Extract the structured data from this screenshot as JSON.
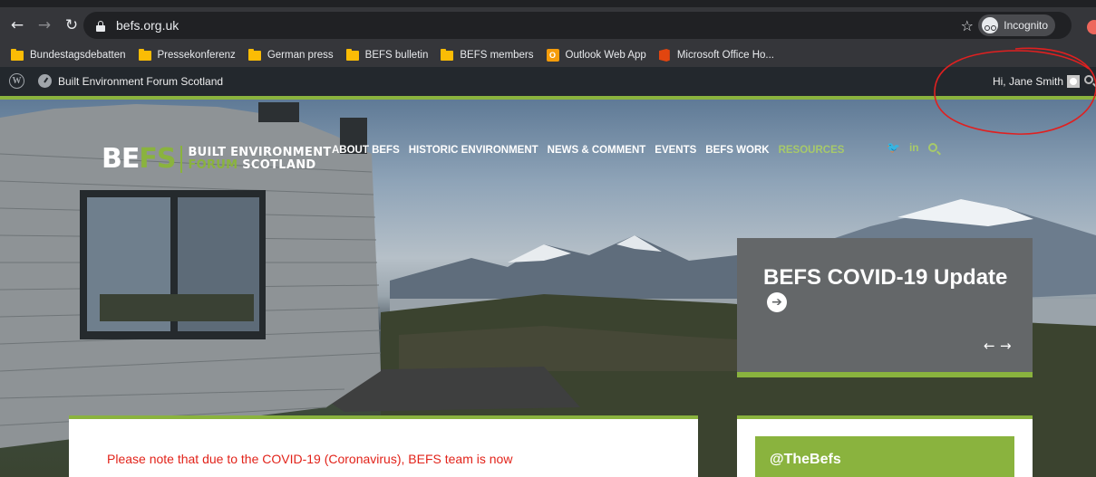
{
  "browser": {
    "url": "befs.org.uk",
    "incognito_label": "Incognito",
    "bookmarks": [
      {
        "label": "Bundestagsdebatten",
        "icon": "folder-icon"
      },
      {
        "label": "Pressekonferenz",
        "icon": "folder-icon"
      },
      {
        "label": "German press",
        "icon": "folder-icon"
      },
      {
        "label": "BEFS bulletin",
        "icon": "folder-icon"
      },
      {
        "label": "BEFS members",
        "icon": "folder-icon"
      },
      {
        "label": "Outlook Web App",
        "icon": "outlook-icon"
      },
      {
        "label": "Microsoft Office Ho...",
        "icon": "office-icon"
      }
    ]
  },
  "adminbar": {
    "site_name": "Built Environment Forum Scotland",
    "greeting": "Hi, Jane Smith"
  },
  "logo": {
    "befs_part1": "BE",
    "befs_part2": "FS",
    "line1": "BUILT ENVIRONMENT",
    "line2_green": "FORUM",
    "line2_white": " SCOTLAND"
  },
  "nav": {
    "items": [
      "ABOUT BEFS",
      "HISTORIC ENVIRONMENT",
      "NEWS & COMMENT",
      "EVENTS",
      "BEFS WORK",
      "RESOURCES"
    ]
  },
  "social": {
    "twitter_glyph": "🐦",
    "linkedin_glyph": "in"
  },
  "feature": {
    "title": "BEFS COVID-19 Update",
    "arrow": "➔",
    "prev": "←",
    "next": "→"
  },
  "content": {
    "notice": "Please note that due to the COVID-19 (Coronavirus), BEFS team is now"
  },
  "sidebar": {
    "twitter_handle": "@TheBefs"
  },
  "colors": {
    "brand_green": "#8ab33e",
    "notice_red": "#e2231a",
    "card_grey": "#646769",
    "annotation_red": "#e02020"
  }
}
